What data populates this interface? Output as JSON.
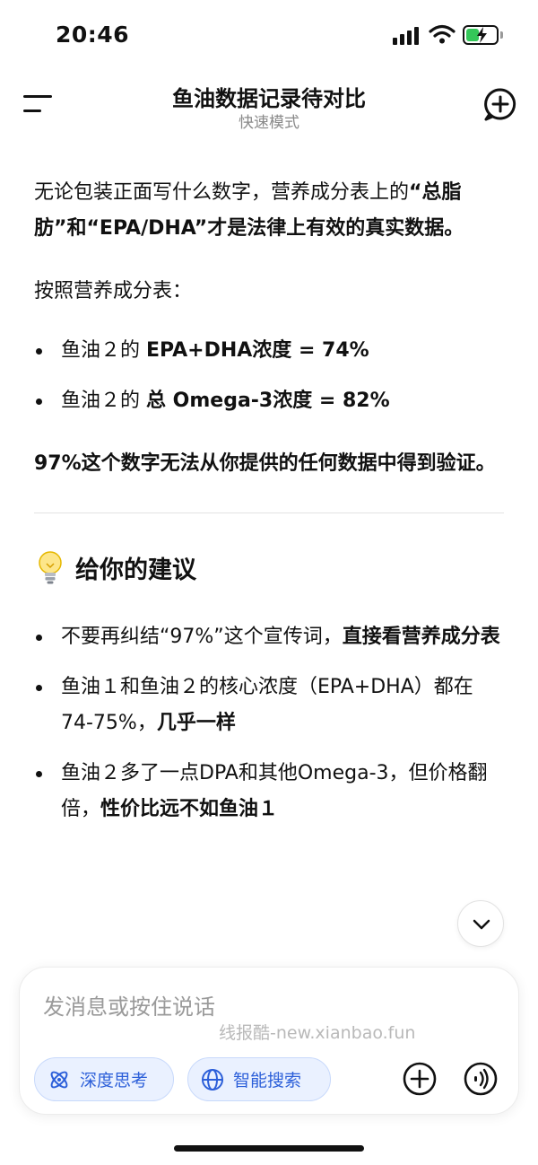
{
  "status_bar": {
    "time": "20:46",
    "icons": [
      "signal-icon",
      "wifi-icon",
      "battery-charging-icon"
    ],
    "battery_color": "#34c759"
  },
  "header": {
    "title": "鱼油数据记录待对比",
    "subtitle": "快速模式",
    "left_icon": "menu-icon",
    "right_icon": "new-chat-icon"
  },
  "message": {
    "intro_plain": "无论包装正面写什么数字，营养成分表上的",
    "intro_bold_line": "“总脂肪”和“EPA/DHA”才是法律上有效的真实数据。",
    "lead": "按照营养成分表：",
    "bullets": [
      {
        "plain": "鱼油２的 ",
        "bold": "EPA+DHA浓度 = 74%"
      },
      {
        "plain": "鱼油２的 ",
        "bold": "总 Omega-3浓度 = 82%"
      }
    ],
    "conclusion": "97%这个数字无法从你提供的任何数据中得到验证。",
    "section_title": "给你的建议",
    "section_icon": "lightbulb-icon",
    "advice": [
      {
        "plain": "不要再纠结“97%”这个宣传词，",
        "bold": "直接看营养成分表"
      },
      {
        "plain": "鱼油１和鱼油２的核心浓度（EPA+DHA）都在74-75%，",
        "bold": "几乎一样"
      },
      {
        "plain": "鱼油２多了一点DPA和其他Omega-3，但价格翻倍，",
        "bold": "性价比远不如鱼油１"
      }
    ]
  },
  "scroll_button": {
    "icon": "chevron-down-icon"
  },
  "composer": {
    "placeholder": "发消息或按住说话",
    "watermark": "线报酷-new.xianbao.fun",
    "chips": [
      {
        "label": "深度思考",
        "icon": "atom-icon"
      },
      {
        "label": "智能搜索",
        "icon": "globe-icon"
      }
    ],
    "accent_color": "#2c5fd9",
    "plus_icon": "plus-circle-icon",
    "voice_icon": "voice-icon"
  }
}
